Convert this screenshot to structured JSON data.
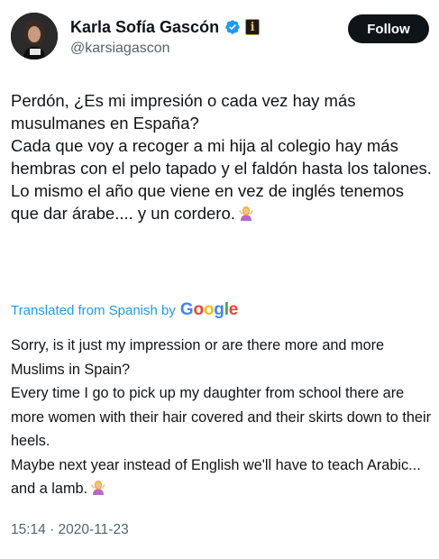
{
  "author": {
    "name": "Karla Sofía Gascón",
    "handle": "@karsiagascon",
    "verified_icon": "verified-badge-icon",
    "affiliate_badge": "i"
  },
  "follow_label": "Follow",
  "tweet": {
    "lines": [
      "Perdón, ¿Es mi impresión o cada vez hay más musulmanes en España?",
      "Cada que voy a recoger a mi hija al colegio hay más hembras con el pelo tapado y el faldón hasta los talones.",
      "Lo mismo el año que viene en vez de inglés tenemos que dar árabe.... y un cordero."
    ],
    "emoji": "woman-shrugging"
  },
  "translation": {
    "prefix": "Translated from Spanish by",
    "provider": "Google",
    "lines": [
      "Sorry, is it just my impression or are there more and more Muslims in Spain?",
      "Every time I go to pick up my daughter from school there are more women with their hair covered and their skirts down to their heels.",
      "Maybe next year instead of English we'll have to teach Arabic... and a lamb."
    ]
  },
  "timestamp": "15:14 · 2020-11-23",
  "colors": {
    "link": "#1d9bf0",
    "muted": "#536471",
    "text": "#0f1419",
    "button": "#0f1419"
  }
}
